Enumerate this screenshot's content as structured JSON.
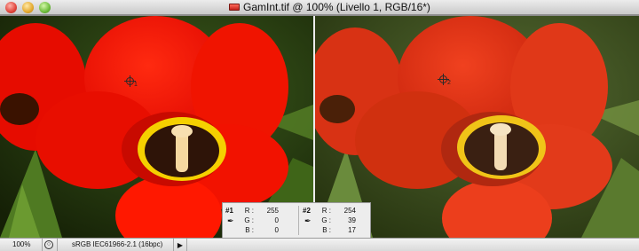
{
  "window": {
    "title": "GamInt.tif @ 100% (Livello 1, RGB/16*)"
  },
  "samplers": [
    {
      "id": "1",
      "label": "1"
    },
    {
      "id": "2",
      "label": "2"
    }
  ],
  "info_panel": {
    "sampler1": {
      "tag": "#1",
      "r_label": "R :",
      "g_label": "G :",
      "b_label": "B :",
      "r": "255",
      "g": "0",
      "b": "0"
    },
    "sampler2": {
      "tag": "#2",
      "r_label": "R :",
      "g_label": "G :",
      "b_label": "B :",
      "r": "254",
      "g": "39",
      "b": "17"
    }
  },
  "statusbar": {
    "zoom": "100%",
    "profile": "sRGB IEC61966-2.1 (16bpc)",
    "arrow": "▶"
  },
  "icons": {
    "close": "close-icon",
    "minimize": "minimize-icon",
    "zoom": "zoom-icon",
    "document": "document-icon",
    "eyedropper": "eyedropper-icon",
    "globe": "globe-icon"
  }
}
